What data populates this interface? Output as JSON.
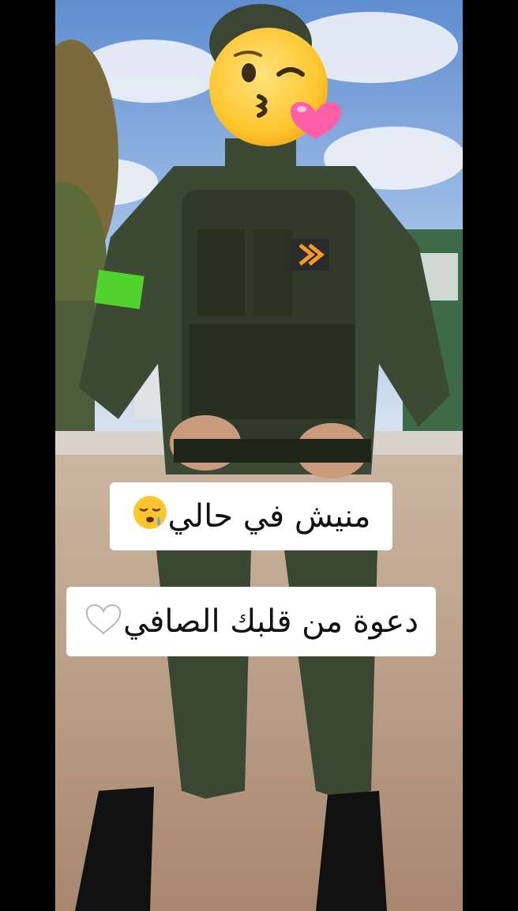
{
  "captions": {
    "line1": {
      "text": "منيش في حالي",
      "emoji": "sleepy-face-icon"
    },
    "line2": {
      "text": "دعوة من قلبك الصافي",
      "emoji": "white-heart-icon"
    }
  },
  "photo": {
    "sky_color": "#8fb6e2",
    "ground_color": "#b9a089",
    "uniform_color": "#3c4a35",
    "armband_color": "#52d22d",
    "face_cover_emoji": "face-blowing-kiss-icon"
  }
}
